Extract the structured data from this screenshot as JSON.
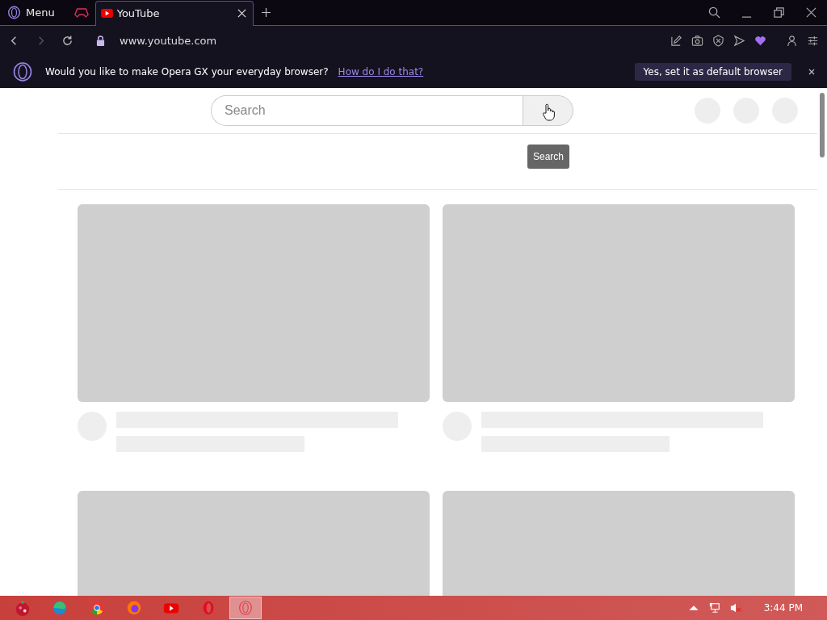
{
  "window": {
    "menu_label": "Menu"
  },
  "tabs": [
    {
      "title": "YouTube",
      "selected": true
    }
  ],
  "address_bar": {
    "url": "www.youtube.com",
    "secure": true
  },
  "banner": {
    "message": "Would you like to make Opera GX your everyday browser?",
    "link": "How do I do that?",
    "button": "Yes, set it as default browser"
  },
  "search": {
    "placeholder": "Search",
    "tooltip": "Search"
  },
  "taskbar": {
    "apps": [
      {
        "kind": "ornament",
        "selected": false
      },
      {
        "kind": "edge",
        "selected": false
      },
      {
        "kind": "chrome",
        "selected": false
      },
      {
        "kind": "firefox",
        "selected": false
      },
      {
        "kind": "youtube",
        "selected": false
      },
      {
        "kind": "opera",
        "selected": false
      },
      {
        "kind": "operagx",
        "selected": true
      }
    ],
    "clock": "3:44 PM"
  }
}
